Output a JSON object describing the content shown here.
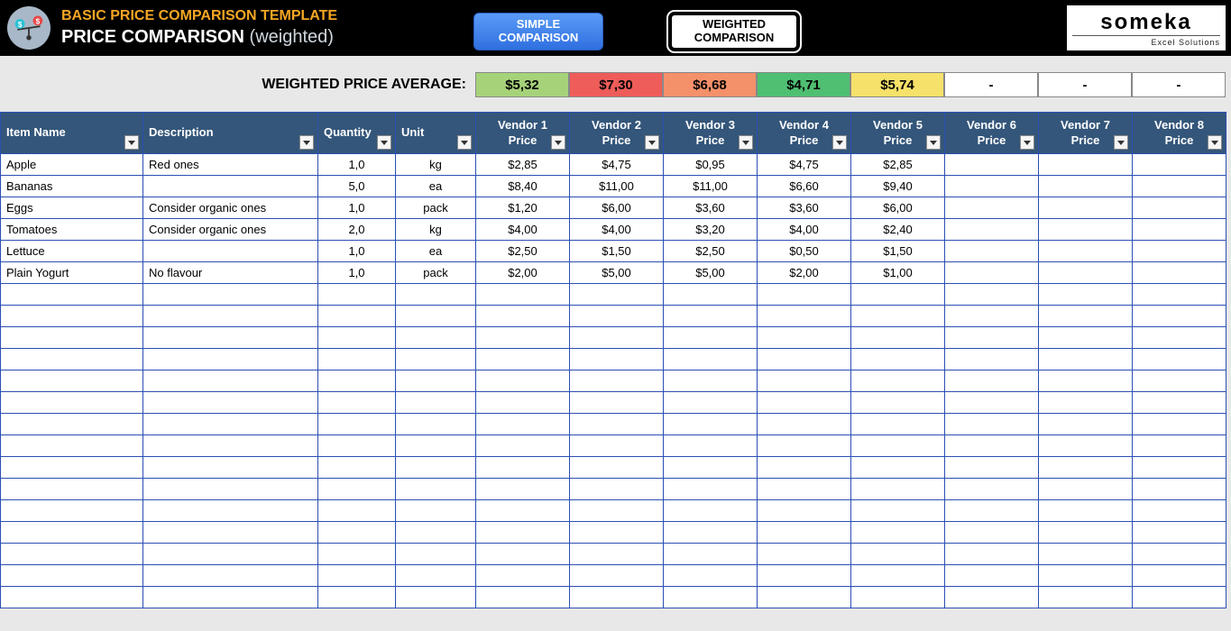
{
  "header": {
    "template_title": "BASIC PRICE COMPARISON TEMPLATE",
    "page_title_prefix": "PRICE COMPARISON",
    "page_title_suffix": "(weighted)",
    "tab_simple_l1": "SIMPLE",
    "tab_simple_l2": "COMPARISON",
    "tab_weighted_l1": "WEIGHTED",
    "tab_weighted_l2": "COMPARISON",
    "logo_big": "someka",
    "logo_small": "Excel Solutions"
  },
  "averages": {
    "label": "WEIGHTED PRICE AVERAGE:",
    "cells": [
      {
        "value": "$5,32",
        "bg": "#a6d27a"
      },
      {
        "value": "$7,30",
        "bg": "#ef5d5a"
      },
      {
        "value": "$6,68",
        "bg": "#f4906a"
      },
      {
        "value": "$4,71",
        "bg": "#4fbf72"
      },
      {
        "value": "$5,74",
        "bg": "#f6e16a"
      },
      {
        "value": "-",
        "bg": "#ffffff"
      },
      {
        "value": "-",
        "bg": "#ffffff"
      },
      {
        "value": "-",
        "bg": "#ffffff"
      }
    ]
  },
  "columns": {
    "item": "Item Name",
    "desc": "Description",
    "qty": "Quantity",
    "unit": "Unit",
    "vendors": [
      "Vendor 1 Price",
      "Vendor 2 Price",
      "Vendor 3 Price",
      "Vendor 4 Price",
      "Vendor 5 Price",
      "Vendor 6 Price",
      "Vendor 7 Price",
      "Vendor 8 Price"
    ]
  },
  "rows": [
    {
      "item": "Apple",
      "desc": "Red ones",
      "qty": "1,0",
      "unit": "kg",
      "prices": [
        "$2,85",
        "$4,75",
        "$0,95",
        "$4,75",
        "$2,85",
        "",
        "",
        ""
      ]
    },
    {
      "item": "Bananas",
      "desc": "",
      "qty": "5,0",
      "unit": "ea",
      "prices": [
        "$8,40",
        "$11,00",
        "$11,00",
        "$6,60",
        "$9,40",
        "",
        "",
        ""
      ]
    },
    {
      "item": "Eggs",
      "desc": "Consider organic ones",
      "qty": "1,0",
      "unit": "pack",
      "prices": [
        "$1,20",
        "$6,00",
        "$3,60",
        "$3,60",
        "$6,00",
        "",
        "",
        ""
      ]
    },
    {
      "item": "Tomatoes",
      "desc": "Consider organic ones",
      "qty": "2,0",
      "unit": "kg",
      "prices": [
        "$4,00",
        "$4,00",
        "$3,20",
        "$4,00",
        "$2,40",
        "",
        "",
        ""
      ]
    },
    {
      "item": "Lettuce",
      "desc": "",
      "qty": "1,0",
      "unit": "ea",
      "prices": [
        "$2,50",
        "$1,50",
        "$2,50",
        "$0,50",
        "$1,50",
        "",
        "",
        ""
      ]
    },
    {
      "item": "Plain Yogurt",
      "desc": "No flavour",
      "qty": "1,0",
      "unit": "pack",
      "prices": [
        "$2,00",
        "$5,00",
        "$5,00",
        "$2,00",
        "$1,00",
        "",
        "",
        ""
      ]
    }
  ],
  "empty_rows": 15
}
